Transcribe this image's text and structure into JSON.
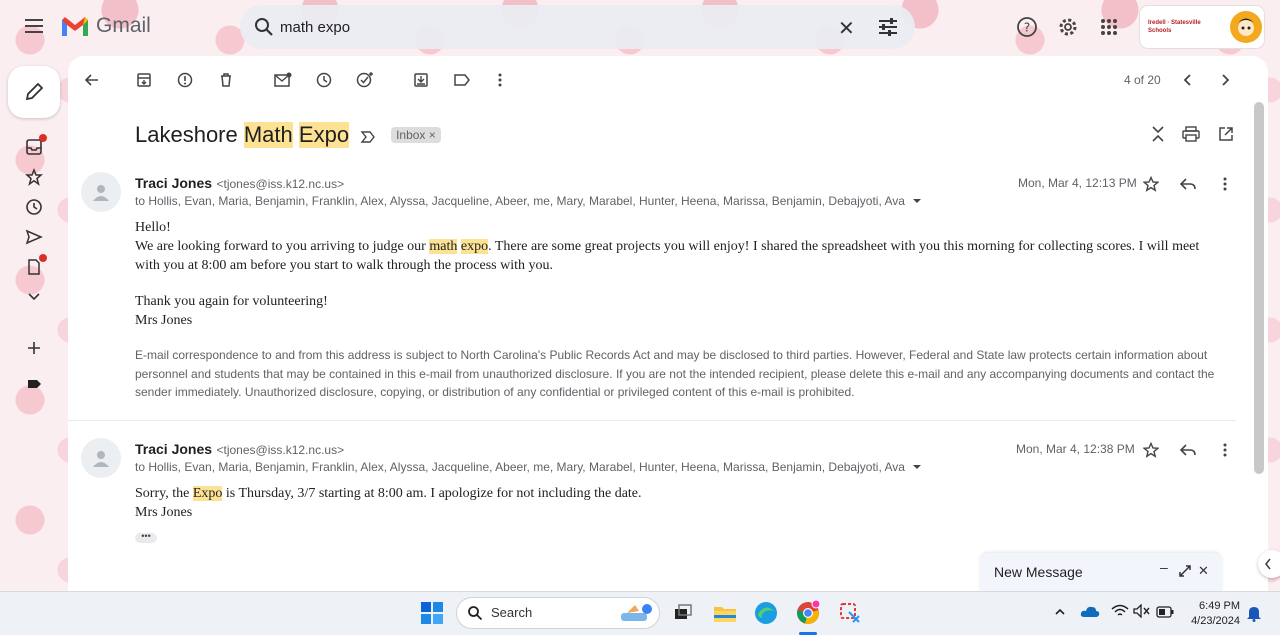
{
  "app": {
    "name": "Gmail"
  },
  "search": {
    "query": "math expo"
  },
  "school": {
    "logo_text": "Iredell · Statesville Schools"
  },
  "pager": {
    "text": "4 of 20"
  },
  "thread": {
    "subject_parts": [
      "Lakeshore ",
      "Math",
      " ",
      "Expo"
    ],
    "label": "Inbox",
    "label_close": "×"
  },
  "messages": [
    {
      "sender": "Traci Jones",
      "email": "<tjones@iss.k12.nc.us>",
      "recipients": "to Hollis, Evan, Maria, Benjamin, Franklin, Alex, Alyssa, Jacqueline, Abeer, me, Mary, Marabel, Hunter, Heena, Marissa, Benjamin, Debajyoti, Ava",
      "date": "Mon, Mar 4, 12:13 PM",
      "greeting": "Hello!",
      "line1_a": "We are looking forward to you arriving to judge our ",
      "line1_hl1": "math",
      "line1_sp": " ",
      "line1_hl2": "expo",
      "line1_b": ". There are some great projects you will enjoy! I shared the spreadsheet with you this morning for collecting scores. I will meet with you at 8:00 am before you start to walk through the process with you.",
      "thanks": "Thank you again for volunteering!",
      "signature": "Mrs Jones",
      "disclaimer": "E-mail correspondence to and from this address is subject to North Carolina's Public Records Act and may be disclosed to third parties. However, Federal and State law protects certain information about personnel and students that may be contained in this e-mail from unauthorized disclosure. If you are not the intended recipient, please delete this e-mail and any accompanying documents and contact the sender immediately. Unauthorized disclosure, copying, or distribution of any confidential or privileged content of this e-mail is prohibited."
    },
    {
      "sender": "Traci Jones",
      "email": "<tjones@iss.k12.nc.us>",
      "recipients": "to Hollis, Evan, Maria, Benjamin, Franklin, Alex, Alyssa, Jacqueline, Abeer, me, Mary, Marabel, Hunter, Heena, Marissa, Benjamin, Debajyoti, Ava",
      "date": "Mon, Mar 4, 12:38 PM",
      "line1_a": "Sorry, the ",
      "line1_hl": "Expo",
      "line1_b": " is Thursday, 3/7 starting at 8:00 am. I apologize for not including the date.",
      "signature": "Mrs Jones",
      "ellipsis": "•••"
    }
  ],
  "new_message": {
    "title": "New Message",
    "minimize": "–",
    "close": "✕"
  },
  "taskbar": {
    "search_label": "Search",
    "time": "6:49 PM",
    "date": "4/23/2024"
  },
  "colors": {
    "highlight": "#fde293",
    "gmail_red": "#ea4335",
    "gmail_blue": "#4285f4",
    "gmail_green": "#34a853",
    "gmail_yellow": "#fbbc04",
    "unread_dot": "#d93025"
  }
}
